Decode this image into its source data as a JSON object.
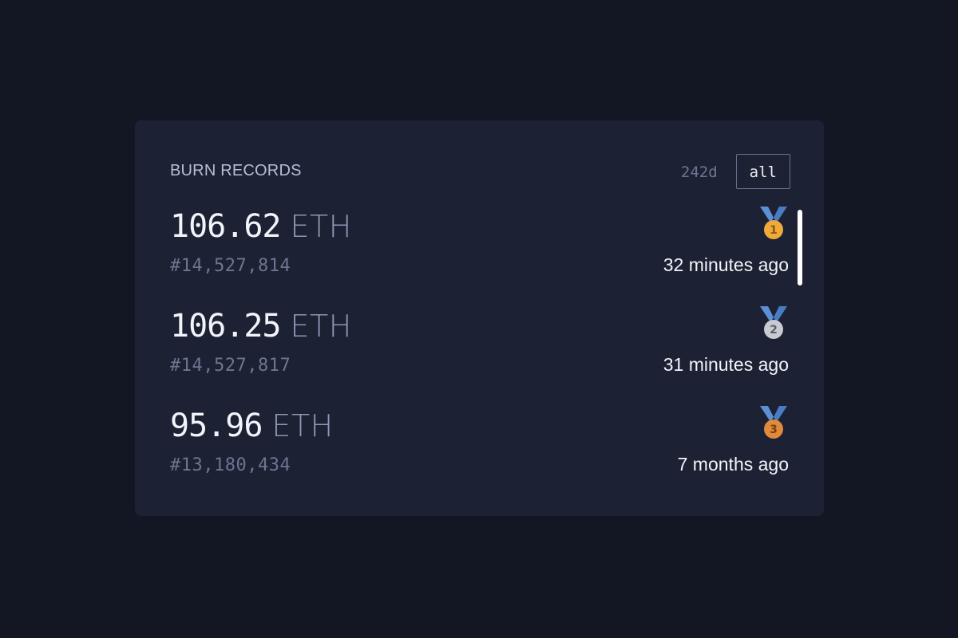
{
  "card": {
    "title": "BURN RECORDS",
    "ranges": [
      {
        "label": "242d",
        "active": false
      },
      {
        "label": "all",
        "active": true
      }
    ]
  },
  "records": [
    {
      "amount": "106.62",
      "unit": "ETH",
      "block": "#14,527,814",
      "ago": "32 minutes ago",
      "medal": "gold-medal-icon",
      "medal_number": "1"
    },
    {
      "amount": "106.25",
      "unit": "ETH",
      "block": "#14,527,817",
      "ago": "31 minutes ago",
      "medal": "silver-medal-icon",
      "medal_number": "2"
    },
    {
      "amount": "95.96",
      "unit": "ETH",
      "block": "#13,180,434",
      "ago": "7 months ago",
      "medal": "bronze-medal-icon",
      "medal_number": "3"
    }
  ],
  "colors": {
    "background": "#131724",
    "card": "#1c2133",
    "gold": "#f0a93b",
    "silver": "#c8ccd2",
    "bronze": "#e08a3c",
    "ribbon": "#5b8fd6"
  }
}
